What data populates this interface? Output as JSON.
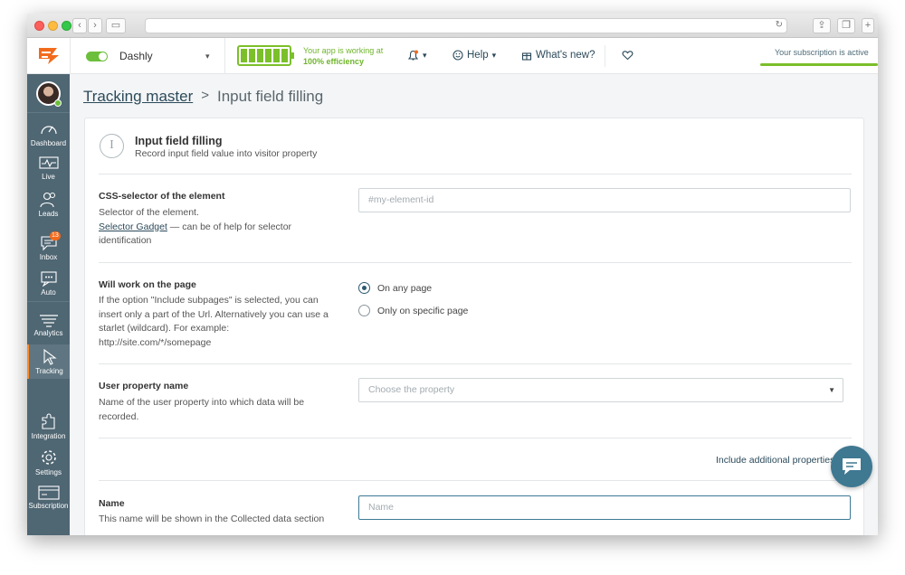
{
  "topbar": {
    "app_name": "Dashly",
    "efficiency_line1": "Your app is working at",
    "efficiency_line2": "100% efficiency",
    "help_label": "Help",
    "whats_new_label": "What's new?",
    "subscription_text": "Your subscription is active",
    "accent_color": "#7bbf2a"
  },
  "sidebar": {
    "items": [
      {
        "label": "Dashboard",
        "icon": "gauge-icon"
      },
      {
        "label": "Live",
        "icon": "pulse-icon"
      },
      {
        "label": "Leads",
        "icon": "users-icon"
      },
      {
        "label": "Inbox",
        "icon": "chat-icon",
        "badge": "13"
      },
      {
        "label": "Auto",
        "icon": "auto-message-icon"
      },
      {
        "label": "Analytics",
        "icon": "filter-icon"
      },
      {
        "label": "Tracking",
        "icon": "cursor-icon",
        "active": true
      },
      {
        "label": "Integration",
        "icon": "puzzle-icon"
      },
      {
        "label": "Settings",
        "icon": "gear-icon"
      },
      {
        "label": "Subscription",
        "icon": "card-icon"
      }
    ]
  },
  "breadcrumb": {
    "parent": "Tracking master",
    "separator": ">",
    "current": "Input field filling"
  },
  "header": {
    "title": "Input field filling",
    "subtitle": "Record input field value into visitor property"
  },
  "fields": {
    "css_selector": {
      "title": "CSS-selector of the element",
      "desc_line1": "Selector of the element.",
      "link": "Selector Gadget",
      "desc_line2": " — can be of help for selector identification",
      "placeholder": "#my-element-id"
    },
    "page": {
      "title": "Will work on the page",
      "desc": "If the option \"Include subpages\" is selected, you can insert only a part of the Url. Alternatively you can use a starlet (wildcard). For example: http://site.com/*/somepage",
      "option1": "On any page",
      "option2": "Only on specific page",
      "selected": "On any page"
    },
    "user_property": {
      "title": "User property name",
      "desc": "Name of the user property into which data will be recorded.",
      "placeholder": "Choose the property"
    },
    "additional": "Include additional properties",
    "name": {
      "title": "Name",
      "desc": "This name will be shown in the Collected data section",
      "placeholder": "Name"
    }
  }
}
